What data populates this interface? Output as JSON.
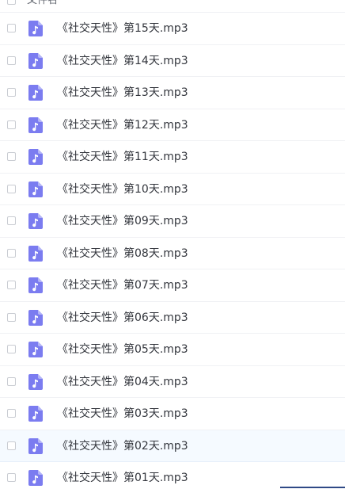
{
  "header": {
    "column_label": "文件名"
  },
  "files": [
    {
      "name": "《社交天性》第15天.mp3"
    },
    {
      "name": "《社交天性》第14天.mp3"
    },
    {
      "name": "《社交天性》第13天.mp3"
    },
    {
      "name": "《社交天性》第12天.mp3"
    },
    {
      "name": "《社交天性》第11天.mp3"
    },
    {
      "name": "《社交天性》第10天.mp3"
    },
    {
      "name": "《社交天性》第09天.mp3"
    },
    {
      "name": "《社交天性》第08天.mp3"
    },
    {
      "name": "《社交天性》第07天.mp3"
    },
    {
      "name": "《社交天性》第06天.mp3"
    },
    {
      "name": "《社交天性》第05天.mp3"
    },
    {
      "name": "《社交天性》第04天.mp3"
    },
    {
      "name": "《社交天性》第03天.mp3"
    },
    {
      "name": "《社交天性》第02天.mp3",
      "hovered": true
    },
    {
      "name": "《社交天性》第01天.mp3"
    }
  ],
  "colors": {
    "icon": "#7b7cf0",
    "hover_row": "#f5faff"
  },
  "icon_name": "audio-file-icon"
}
